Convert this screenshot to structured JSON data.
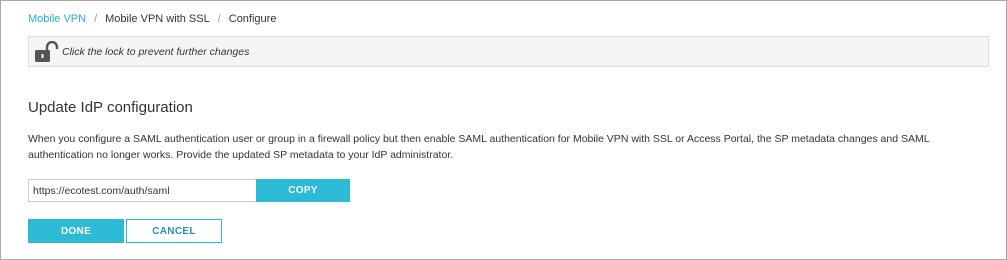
{
  "breadcrumb": {
    "items": [
      "Mobile VPN",
      "Mobile VPN with SSL",
      "Configure"
    ],
    "separator": "/"
  },
  "lock_bar": {
    "icon": "unlocked-padlock-icon",
    "text": "Click the lock to prevent further changes"
  },
  "section": {
    "title": "Update IdP configuration",
    "description": "When you configure a SAML authentication user or group in a firewall policy but then enable SAML authentication for Mobile VPN with SSL or Access Portal, the SP metadata changes and SAML authentication no longer works. Provide the updated SP metadata to your IdP administrator."
  },
  "url_field": {
    "value": "https://ecotest.com/auth/saml",
    "copy_label": "COPY"
  },
  "actions": {
    "done_label": "DONE",
    "cancel_label": "CANCEL"
  },
  "colors": {
    "accent": "#2cbad7",
    "link": "#2aaed6",
    "border": "#a9a9a9"
  }
}
